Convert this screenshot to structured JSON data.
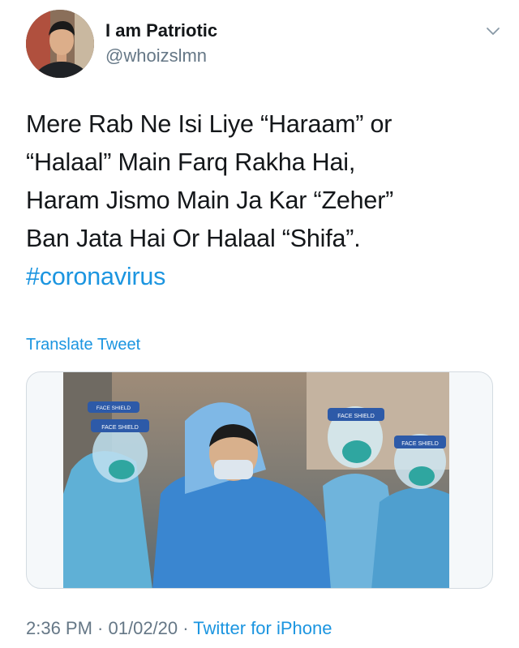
{
  "author": {
    "display_name": "I am Patriotic",
    "handle": "@whoizslmn",
    "avatar_icon": "profile-avatar"
  },
  "tweet": {
    "lines": [
      "Mere Rab Ne Isi Liye “Haraam” or",
      "“Halaal” Main Farq Rakha Hai,",
      "Haram Jismo Main Ja Kar “Zeher”",
      "Ban Jata Hai Or Halaal “Shifa”."
    ],
    "hashtag": "#coronavirus",
    "translate_label": "Translate Tweet"
  },
  "media": {
    "description_icon": "photo",
    "shield_labels": [
      "FACE SHIELD",
      "FACE SHIELD",
      "FACE SHIELD",
      "FACE SHIELD"
    ]
  },
  "meta": {
    "time": "2:36 PM",
    "separator": " · ",
    "date": "01/02/20",
    "source": "Twitter for iPhone"
  },
  "colors": {
    "link": "#1b95e0",
    "secondary_text": "#657786",
    "primary_text": "#14171a",
    "border": "#d4dbe1"
  }
}
